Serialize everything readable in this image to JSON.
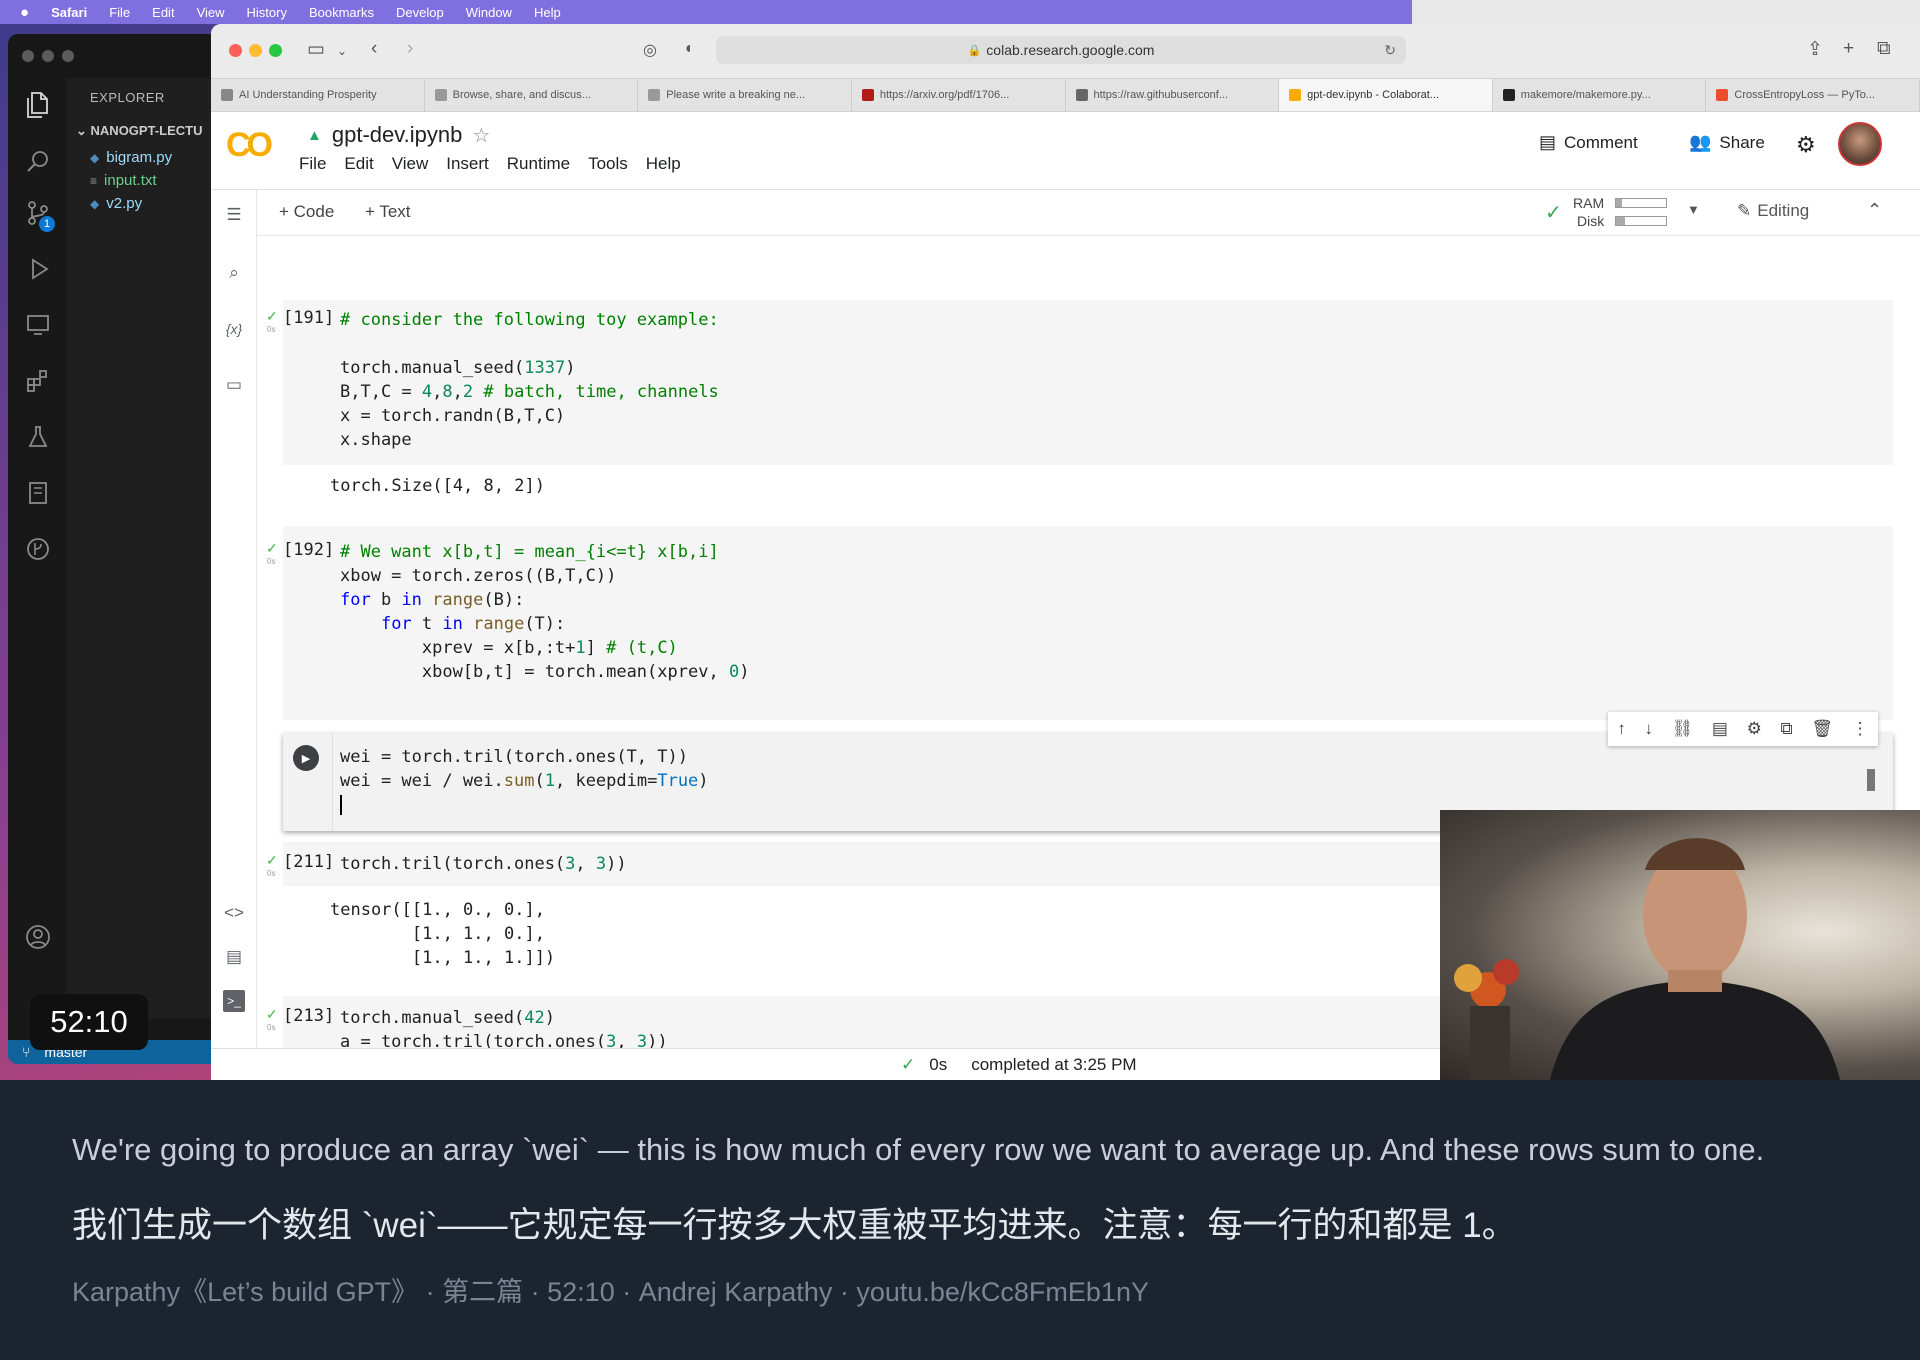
{
  "menubar": {
    "apple_icon": "apple-icon",
    "items": [
      "Safari",
      "File",
      "Edit",
      "View",
      "History",
      "Bookmarks",
      "Develop",
      "Window",
      "Help"
    ]
  },
  "vscode": {
    "explorer_title": "EXPLORER",
    "folder": "NANOGPT-LECTU",
    "files": [
      {
        "name": "bigram.py",
        "color": "#9cdcfe",
        "icon": "python-file-icon"
      },
      {
        "name": "input.txt",
        "color": "#6fce8c",
        "icon": "text-file-icon"
      },
      {
        "name": "v2.py",
        "color": "#9cdcfe",
        "icon": "python-file-icon"
      }
    ],
    "scm_badge": "1",
    "branch": "master",
    "timer": "52:10"
  },
  "safari": {
    "address": "colab.research.google.com",
    "tabs": [
      {
        "label": "AI Understanding Prosperity",
        "fav": "#888"
      },
      {
        "label": "Browse, share, and discus...",
        "fav": "#999"
      },
      {
        "label": "Please write a breaking ne...",
        "fav": "#999"
      },
      {
        "label": "https://arxiv.org/pdf/1706...",
        "fav": "#b31b1b"
      },
      {
        "label": "https://raw.githubuserconf...",
        "fav": "#666"
      },
      {
        "label": "gpt-dev.ipynb - Colaborat...",
        "fav": "#f9ab00",
        "active": true
      },
      {
        "label": "makemore/makemore.py...",
        "fav": "#222"
      },
      {
        "label": "CrossEntropyLoss — PyTo...",
        "fav": "#ee4c2c"
      }
    ]
  },
  "colab": {
    "logo": "CO",
    "notebook_title": "gpt-dev.ipynb",
    "menu": [
      "File",
      "Edit",
      "View",
      "Insert",
      "Runtime",
      "Tools",
      "Help"
    ],
    "comment_label": "Comment",
    "share_label": "Share",
    "add_code": "+ Code",
    "add_text": "+ Text",
    "ram_label": "RAM",
    "disk_label": "Disk",
    "editing_label": "Editing",
    "status_time": "0s",
    "status_text": "completed at 3:25 PM"
  },
  "cells": {
    "c191": {
      "exec": "[191]",
      "zs": "0s",
      "output": "torch.Size([4, 8, 2])"
    },
    "c192": {
      "exec": "[192]",
      "zs": "0s"
    },
    "c211": {
      "exec": "[211]",
      "zs": "0s",
      "output": "tensor([[1., 0., 0.],\n        [1., 1., 0.],\n        [1., 1., 1.]])"
    },
    "c213": {
      "exec": "[213]",
      "zs": "0s"
    }
  },
  "caption": {
    "en": "We're going to produce an array `wei` — this is how much of every row we want to average up. And these rows sum to one.",
    "zh": "我们生成一个数组 `wei`——它规定每一行按多大权重被平均进来。注意：每一行的和都是 1。",
    "source": "Karpathy《Let’s build GPT》 · 第二篇 · 52:10 · Andrej Karpathy · youtu.be/kCc8FmEb1nY"
  }
}
